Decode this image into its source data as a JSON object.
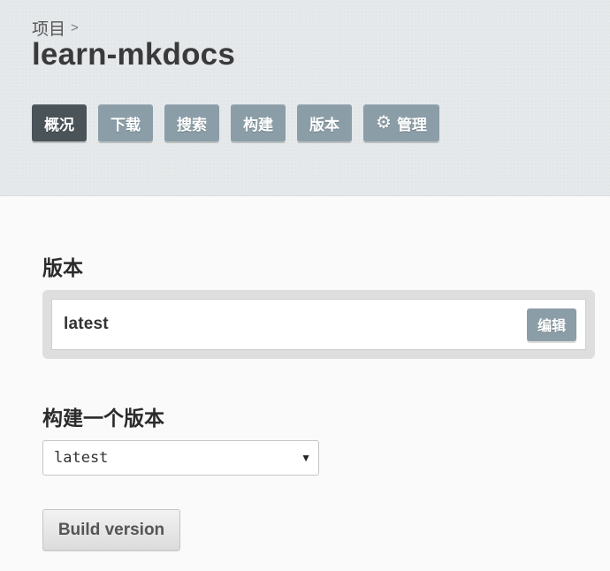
{
  "breadcrumb": {
    "parent": "项目",
    "separator": ">"
  },
  "project": {
    "name": "learn-mkdocs"
  },
  "nav": [
    {
      "label": "概况",
      "active": true
    },
    {
      "label": "下载",
      "active": false
    },
    {
      "label": "搜索",
      "active": false
    },
    {
      "label": "构建",
      "active": false
    },
    {
      "label": "版本",
      "active": false
    },
    {
      "label": "管理",
      "icon": "gear-icon",
      "active": false
    }
  ],
  "versions": {
    "title": "版本",
    "items": [
      {
        "name": "latest",
        "edit_label": "编辑"
      }
    ]
  },
  "build": {
    "title": "构建一个版本",
    "selected_version": "latest",
    "button_label": "Build version"
  },
  "colors": {
    "nav_button": "#8b9ea8",
    "nav_active": "#4a5358",
    "header_bg": "#e6e9eb"
  }
}
